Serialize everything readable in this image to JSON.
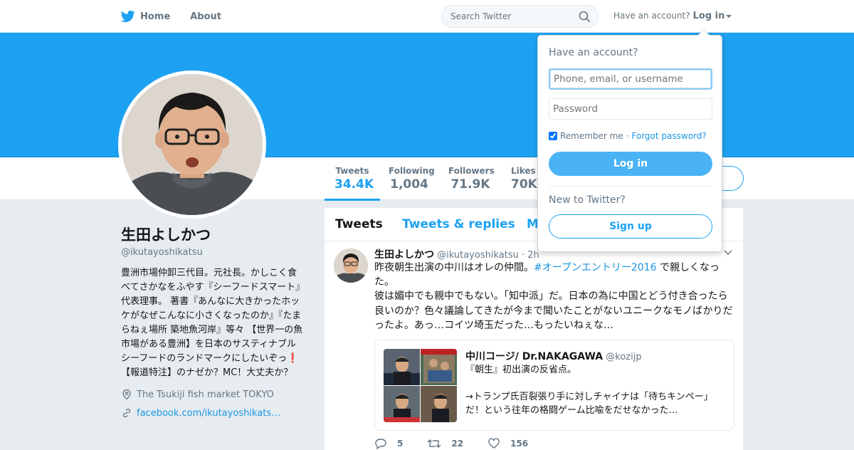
{
  "topnav": {
    "home_label": "Home",
    "about_label": "About",
    "search_placeholder": "Search Twitter",
    "have_account": "Have an account?",
    "login_label": "Log in"
  },
  "profile": {
    "name": "生田よしかつ",
    "handle": "@ikutayoshikatsu",
    "bio": "豊洲市場仲卸三代目。元社長。かしこく食べてさかなをふやす『シーフードスマート』代表理事。 著書『あんなに大きかったホッケがなぜこんなに小さくなったのか』『たまらねぇ場所 築地魚河岸』等々 【世界一の魚市場がある豊洲】を日本のサスティナブルシーフードのランドマークにしたいぞっ❗️【報道特注】のナゼか？MC！大丈夫か？",
    "location": "The Tsukiji fish market TOKYO",
    "link": "facebook.com/ikutayoshikats…"
  },
  "stats": [
    {
      "label": "Tweets",
      "value": "34.4K"
    },
    {
      "label": "Following",
      "value": "1,004"
    },
    {
      "label": "Followers",
      "value": "71.9K"
    },
    {
      "label": "Likes",
      "value": "70K"
    }
  ],
  "timeline": {
    "tabs": [
      "Tweets",
      "Tweets & replies",
      "M"
    ]
  },
  "tweet": {
    "name": "生田よしかつ",
    "handle": "@ikutayoshikatsu",
    "time": "· 2h",
    "line1_pre": "昨夜朝生出演の中川はオレの仲間。",
    "hashtag": "#オープンエントリー2016",
    "line1_post": " で親しくなった。",
    "rest": "彼は媚中でも親中でもない。「知中派」だ。日本の為に中国とどう付き合ったら良いのか？色々議論してきたが今まで聞いたことがないユニークなモノばかりだったよ。あっ…コイツ埼玉だった…もったいねぇな…",
    "quote": {
      "name": "中川コージ/ Dr.NAKAGAWA",
      "handle": "@kozijp",
      "line1": "『朝生』初出演の反省点。",
      "line2": "→トランプ氏百裂張り手に対しチャイナは「待ちキンペー」だ！という往年の格闘ゲーム比喩をだせなかった…"
    },
    "replies": "5",
    "retweets": "22",
    "likes": "156"
  },
  "login": {
    "title": "Have an account?",
    "username_placeholder": "Phone, email, or username",
    "password_placeholder": "Password",
    "remember": "Remember me",
    "forgot": "· Forgot password?",
    "login_button": "Log in",
    "new_prompt": "New to Twitter?",
    "signup_button": "Sign up"
  },
  "colors": {
    "accent": "#1da1f2",
    "banner": "#1da1f2",
    "link": "#1b95e0"
  }
}
